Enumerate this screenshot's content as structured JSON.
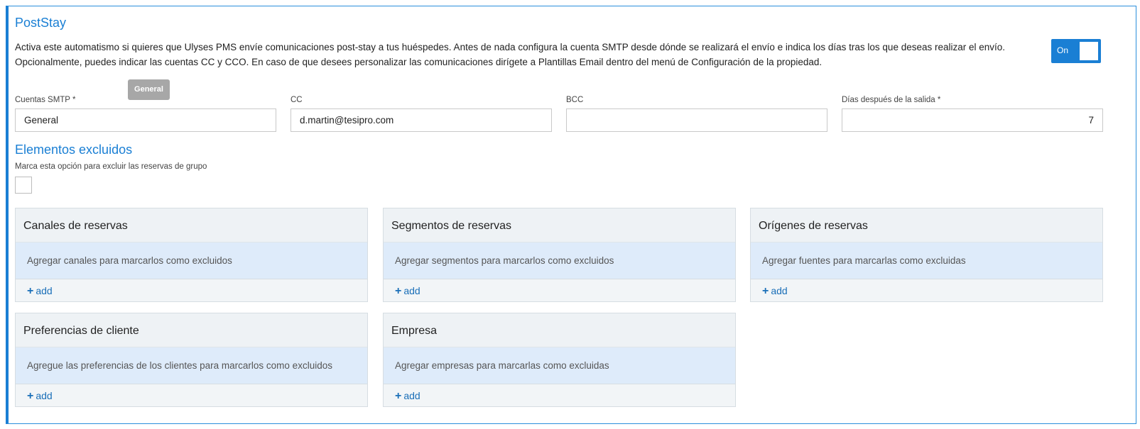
{
  "header": {
    "title": "PostStay",
    "description": "Activa este automatismo si quieres que Ulyses PMS envíe comunicaciones post-stay a tus huéspedes. Antes de nada configura la cuenta SMTP desde dónde se realizará el envío e indica los días tras los que deseas realizar el envío. Opcionalmente, puedes indicar las cuentas CC y CCO. En caso de que desees personalizar las comunicaciones dirígete a Plantillas Email dentro del menú de Configuración de la propiedad.",
    "toggle_label": "On"
  },
  "tooltip": "General",
  "fields": {
    "smtp": {
      "label": "Cuentas SMTP *",
      "value": "General"
    },
    "cc": {
      "label": "CC",
      "value": "d.martin@tesipro.com"
    },
    "bcc": {
      "label": "BCC",
      "value": ""
    },
    "days": {
      "label": "Días después de la salida *",
      "value": "7"
    }
  },
  "excluded": {
    "title": "Elementos excluidos",
    "group_label": "Marca esta opción para excluir las reservas de grupo"
  },
  "cards": [
    {
      "title": "Canales de reservas",
      "placeholder": "Agregar canales para marcarlos como excluidos",
      "add": "add"
    },
    {
      "title": "Segmentos de reservas",
      "placeholder": "Agregar segmentos para marcarlos como excluidos",
      "add": "add"
    },
    {
      "title": "Orígenes de reservas",
      "placeholder": "Agregar fuentes para marcarlas como excluidas",
      "add": "add"
    },
    {
      "title": "Preferencias de cliente",
      "placeholder": "Agregue las preferencias de los clientes para marcarlos como excluidos",
      "add": "add"
    },
    {
      "title": "Empresa",
      "placeholder": "Agregar empresas para marcarlas como excluidas",
      "add": "add"
    }
  ],
  "colors": {
    "accent": "#1a7fd4",
    "tooltip_bg": "#a7a7a7",
    "card_body": "#deebfa"
  }
}
